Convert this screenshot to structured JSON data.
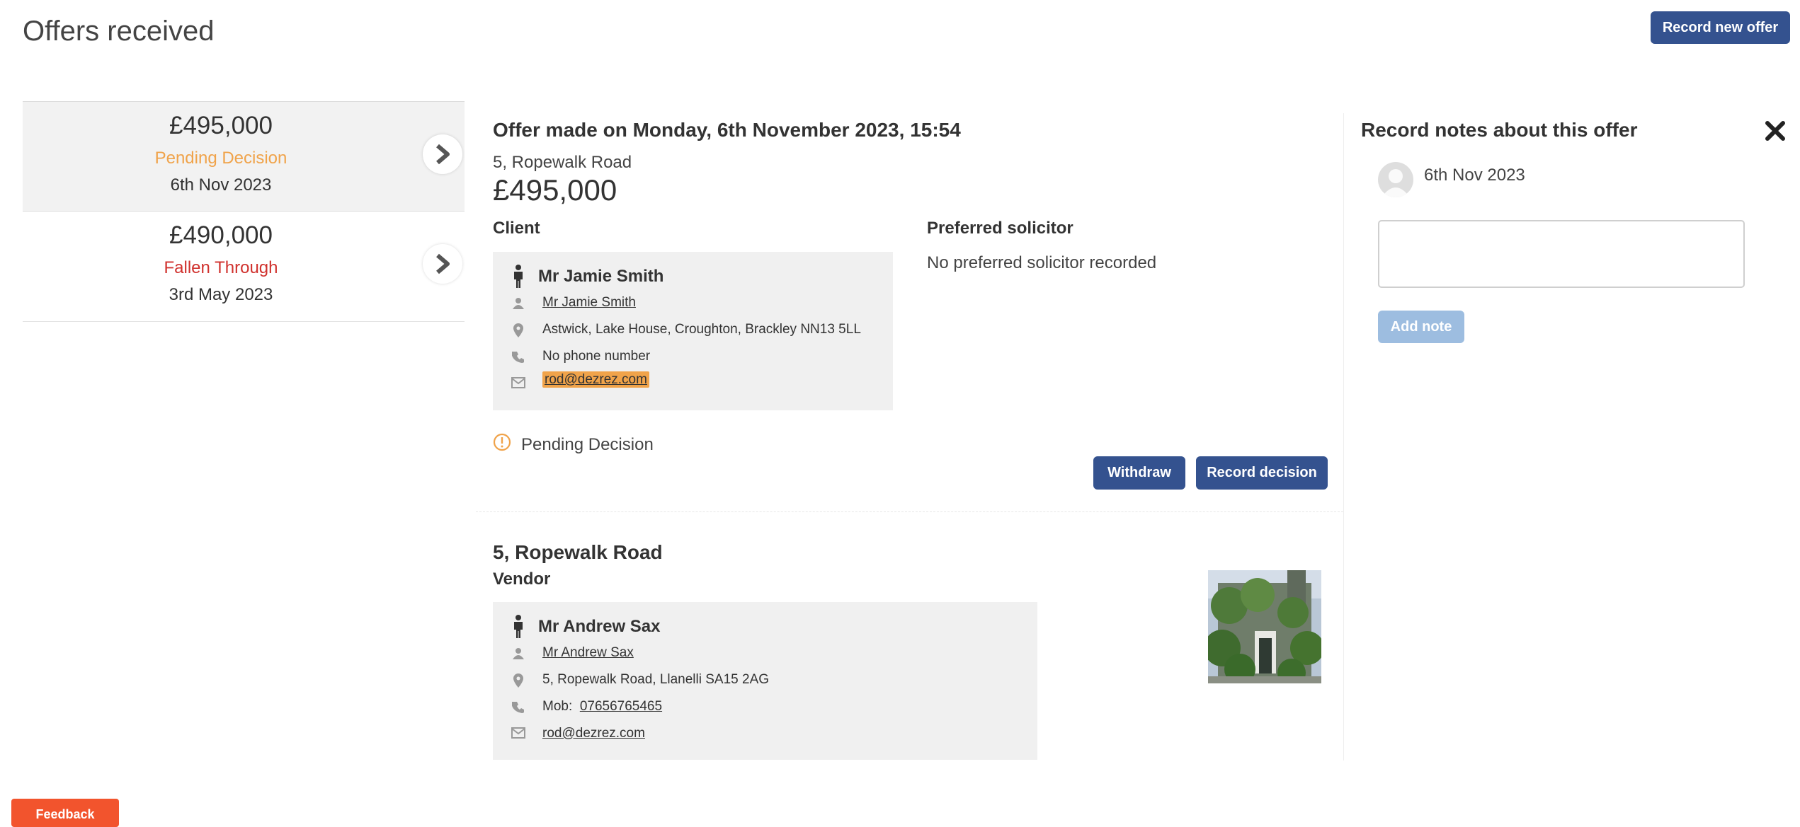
{
  "page": {
    "title": "Offers received",
    "record_new_offer_label": "Record new offer"
  },
  "offers": [
    {
      "amount": "£495,000",
      "status": "Pending Decision",
      "status_color": "#f0a34a",
      "date": "6th Nov 2023"
    },
    {
      "amount": "£490,000",
      "status": "Fallen Through",
      "status_color": "#d0312d",
      "date": "3rd May 2023"
    }
  ],
  "detail": {
    "title": "Offer made on Monday, 6th November 2023, 15:54",
    "address": "5, Ropewalk Road",
    "amount": "£495,000",
    "client_label": "Client",
    "client": {
      "name": "Mr Jamie Smith",
      "link_name": "Mr Jamie Smith",
      "address": "Astwick, Lake House, Croughton, Brackley NN13 5LL",
      "phone": "No phone number",
      "email": "rod@dezrez.com"
    },
    "solicitor_label": "Preferred solicitor",
    "solicitor_value": "No preferred solicitor recorded",
    "status": "Pending Decision",
    "withdraw_label": "Withdraw",
    "record_decision_label": "Record decision"
  },
  "property": {
    "address": "5, Ropewalk Road",
    "vendor_label": "Vendor",
    "vendor": {
      "name": "Mr Andrew Sax",
      "link_name": "Mr Andrew Sax",
      "address": "5, Ropewalk Road, Llanelli SA15 2AG",
      "phone_prefix": "Mob:",
      "phone": "07656765465",
      "email": "rod@dezrez.com"
    }
  },
  "notes": {
    "title": "Record notes about this offer",
    "date": "6th Nov 2023",
    "input_value": "",
    "add_note_label": "Add note"
  },
  "feedback": {
    "label": "Feedback"
  },
  "colors": {
    "primary": "#34528f",
    "pending": "#f0a34a",
    "fallen": "#d0312d",
    "feedback": "#f2542d"
  }
}
